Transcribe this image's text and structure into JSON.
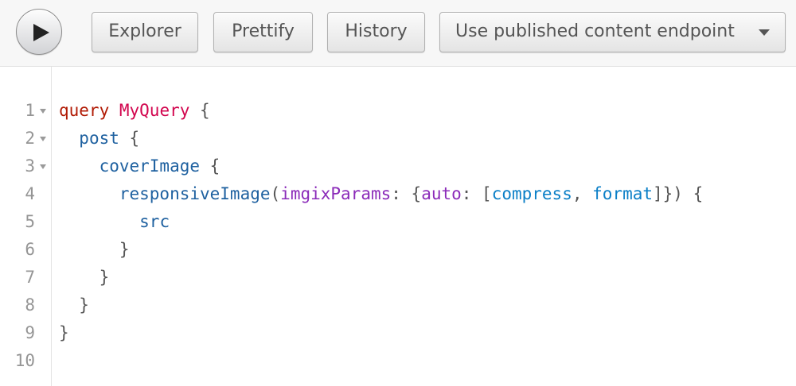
{
  "toolbar": {
    "run_label": "Run query",
    "buttons": {
      "explorer": "Explorer",
      "prettify": "Prettify",
      "history": "History"
    },
    "endpoint_select": {
      "selected": "Use published content endpoint"
    }
  },
  "editor": {
    "lines": [
      {
        "num": "1",
        "foldable": true,
        "tokens": [
          {
            "t": "query",
            "k": "kw"
          },
          {
            "t": " ",
            "k": "punct"
          },
          {
            "t": "MyQuery",
            "k": "def"
          },
          {
            "t": " {",
            "k": "punct"
          }
        ]
      },
      {
        "num": "2",
        "foldable": true,
        "tokens": [
          {
            "t": "  ",
            "k": "punct"
          },
          {
            "t": "post",
            "k": "fld"
          },
          {
            "t": " {",
            "k": "punct"
          }
        ]
      },
      {
        "num": "3",
        "foldable": true,
        "tokens": [
          {
            "t": "    ",
            "k": "punct"
          },
          {
            "t": "coverImage",
            "k": "fld"
          },
          {
            "t": " {",
            "k": "punct"
          }
        ]
      },
      {
        "num": "4",
        "foldable": false,
        "tokens": [
          {
            "t": "      ",
            "k": "punct"
          },
          {
            "t": "responsiveImage",
            "k": "fld"
          },
          {
            "t": "(",
            "k": "punct"
          },
          {
            "t": "imgixParams",
            "k": "attr"
          },
          {
            "t": ": {",
            "k": "punct"
          },
          {
            "t": "auto",
            "k": "attr"
          },
          {
            "t": ": [",
            "k": "punct"
          },
          {
            "t": "compress",
            "k": "enum"
          },
          {
            "t": ", ",
            "k": "punct"
          },
          {
            "t": "format",
            "k": "enum"
          },
          {
            "t": "]}) {",
            "k": "punct"
          }
        ]
      },
      {
        "num": "5",
        "foldable": false,
        "tokens": [
          {
            "t": "        ",
            "k": "punct"
          },
          {
            "t": "src",
            "k": "fld"
          }
        ]
      },
      {
        "num": "6",
        "foldable": false,
        "tokens": [
          {
            "t": "      }",
            "k": "punct"
          }
        ]
      },
      {
        "num": "7",
        "foldable": false,
        "tokens": [
          {
            "t": "    }",
            "k": "punct"
          }
        ]
      },
      {
        "num": "8",
        "foldable": false,
        "tokens": [
          {
            "t": "  }",
            "k": "punct"
          }
        ]
      },
      {
        "num": "9",
        "foldable": false,
        "tokens": [
          {
            "t": "}",
            "k": "punct"
          }
        ]
      },
      {
        "num": "10",
        "foldable": false,
        "tokens": []
      }
    ]
  },
  "colors": {
    "keyword": "#b11a04",
    "definition": "#d2054e",
    "field": "#1f61a0",
    "attribute": "#8b2bb9",
    "enum": "#0b7fc7",
    "punctuation": "#555555",
    "line_number": "#959595"
  },
  "icons": {
    "run": "play-icon",
    "dropdown": "caret-down-icon",
    "fold": "fold-triangle-icon"
  }
}
